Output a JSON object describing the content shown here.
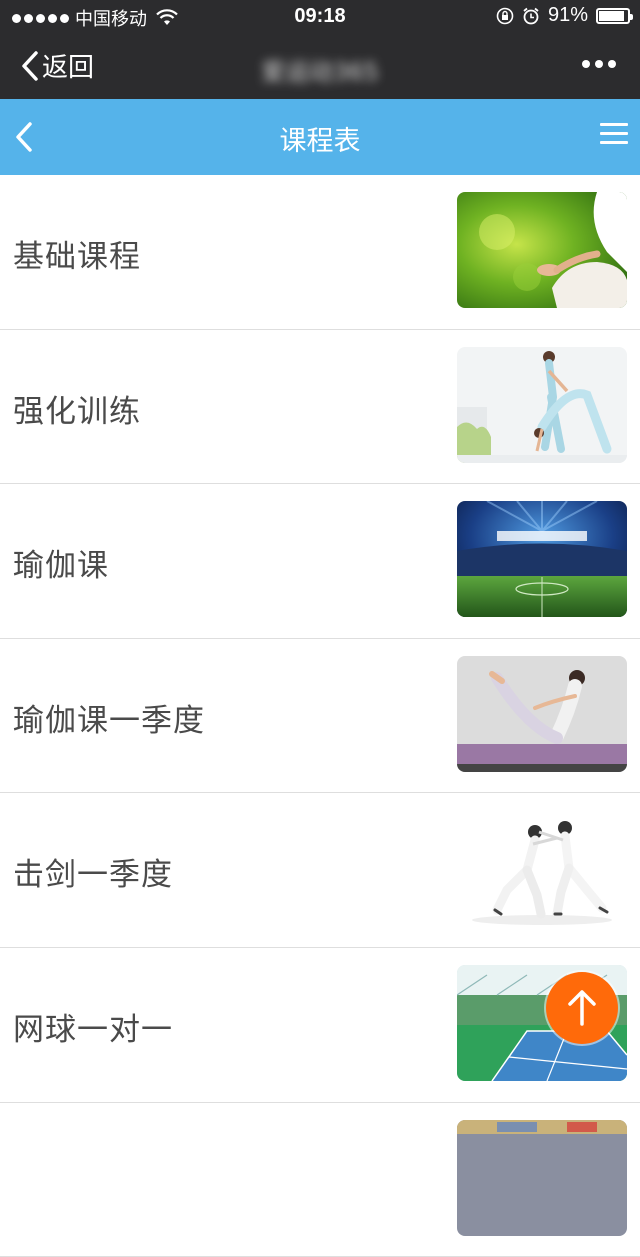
{
  "status_bar": {
    "carrier": "中国移动",
    "time": "09:18",
    "battery_percent": "91%",
    "battery_level": 0.91
  },
  "wechat_bar": {
    "back_label": "返回",
    "title": "爱运动365"
  },
  "app_header": {
    "title": "课程表"
  },
  "courses": [
    {
      "name": "基础课程",
      "thumb": "meditation"
    },
    {
      "name": "强化训练",
      "thumb": "partner-yoga"
    },
    {
      "name": "瑜伽课",
      "thumb": "stadium"
    },
    {
      "name": "瑜伽课一季度",
      "thumb": "yoga-pose"
    },
    {
      "name": "击剑一季度",
      "thumb": "fencing"
    },
    {
      "name": "网球一对一",
      "thumb": "tennis-court"
    }
  ],
  "colors": {
    "header_blue": "#55b3ea",
    "system_bar": "#2c2c2e",
    "to_top_button": "#ff6a0a"
  }
}
